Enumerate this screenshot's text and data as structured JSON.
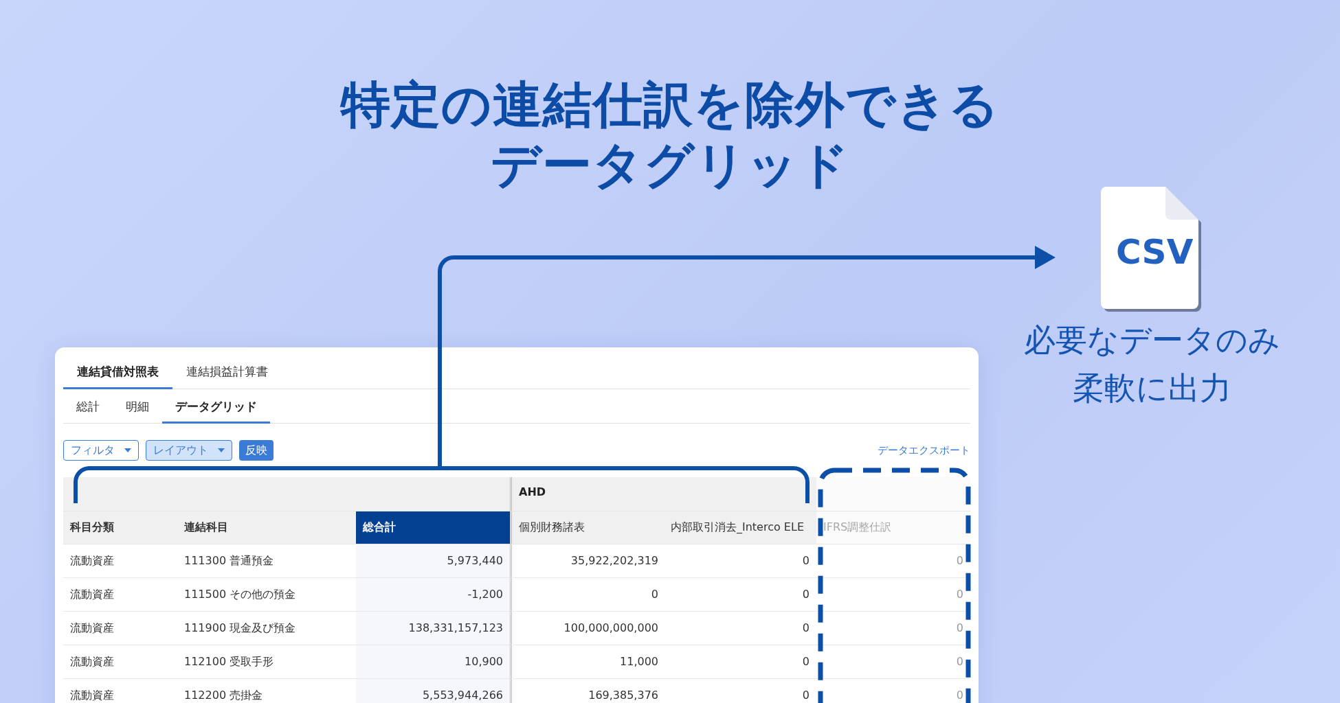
{
  "headline": [
    "特定の連結仕訳を除外できる",
    "データグリッド"
  ],
  "export_file": {
    "type_label": "CSV",
    "caption": [
      "必要なデータのみ",
      "柔軟に出力"
    ]
  },
  "tabs": [
    {
      "label": "連結貸借対照表",
      "selected": true
    },
    {
      "label": "連結損益計算書",
      "selected": false
    }
  ],
  "sub_tabs": [
    {
      "label": "総計",
      "selected": false
    },
    {
      "label": "明細",
      "selected": false
    },
    {
      "label": "データグリッド",
      "selected": true
    }
  ],
  "toolbar": {
    "buttons": [
      {
        "label": "フィルタ",
        "kind": "dropdown",
        "selected": false
      },
      {
        "label": "レイアウト",
        "kind": "dropdown",
        "selected": true
      },
      {
        "label": "反映",
        "kind": "primary",
        "selected": false
      }
    ],
    "export_link": "データエクスポート"
  },
  "table": {
    "group_header": "AHD",
    "columns": [
      {
        "label": "科目分類",
        "selected": false,
        "disabled": false
      },
      {
        "label": "連結科目",
        "selected": false,
        "disabled": false
      },
      {
        "label": "総合計",
        "selected": true,
        "disabled": false
      },
      {
        "label": "個別財務諸表",
        "selected": false,
        "disabled": false
      },
      {
        "label": "内部取引消去_Interco ELE",
        "selected": false,
        "disabled": false
      },
      {
        "label": "IFRS調整仕訳",
        "selected": false,
        "disabled": true
      }
    ],
    "rows": [
      [
        "流動資産",
        "111300 普通預金",
        "5,973,440",
        "35,922,202,319",
        "0",
        "0"
      ],
      [
        "流動資産",
        "111500 その他の預金",
        "-1,200",
        "0",
        "0",
        "0"
      ],
      [
        "流動資産",
        "111900 現金及び預金",
        "138,331,157,123",
        "100,000,000,000",
        "0",
        "0"
      ],
      [
        "流動資産",
        "112100 受取手形",
        "10,900",
        "11,000",
        "0",
        "0"
      ],
      [
        "流動資産",
        "112200 売掛金",
        "5,553,944,266",
        "169,385,376",
        "0",
        "0"
      ]
    ]
  }
}
